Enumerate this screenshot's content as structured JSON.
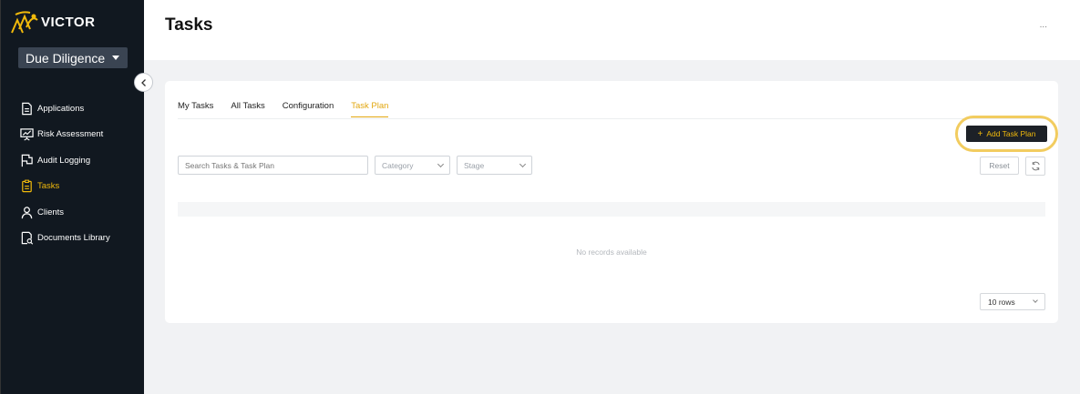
{
  "brand": {
    "name": "VICTOR",
    "accent_color": "#f0b90b"
  },
  "sidebar": {
    "module_select": {
      "value": "Due Diligence"
    },
    "items": [
      {
        "label": "Applications",
        "icon": "document-icon",
        "active": false
      },
      {
        "label": "Risk Assessment",
        "icon": "presentation-chart-icon",
        "active": false
      },
      {
        "label": "Audit Logging",
        "icon": "flag-icon",
        "active": false
      },
      {
        "label": "Tasks",
        "icon": "clipboard-icon",
        "active": true
      },
      {
        "label": "Clients",
        "icon": "user-icon",
        "active": false
      },
      {
        "label": "Documents Library",
        "icon": "document-search-icon",
        "active": false
      }
    ]
  },
  "header": {
    "title": "Tasks",
    "more": "..."
  },
  "tabs": [
    {
      "label": "My Tasks",
      "active": false
    },
    {
      "label": "All Tasks",
      "active": false
    },
    {
      "label": "Configuration",
      "active": false
    },
    {
      "label": "Task Plan",
      "active": true
    }
  ],
  "toolbar": {
    "add_label": "Add Task Plan",
    "search_placeholder": "Search Tasks & Task Plan",
    "category_placeholder": "Category",
    "stage_placeholder": "Stage",
    "reset_label": "Reset"
  },
  "table": {
    "empty_text": "No records available"
  },
  "pagination": {
    "rows_value": "10 rows"
  }
}
